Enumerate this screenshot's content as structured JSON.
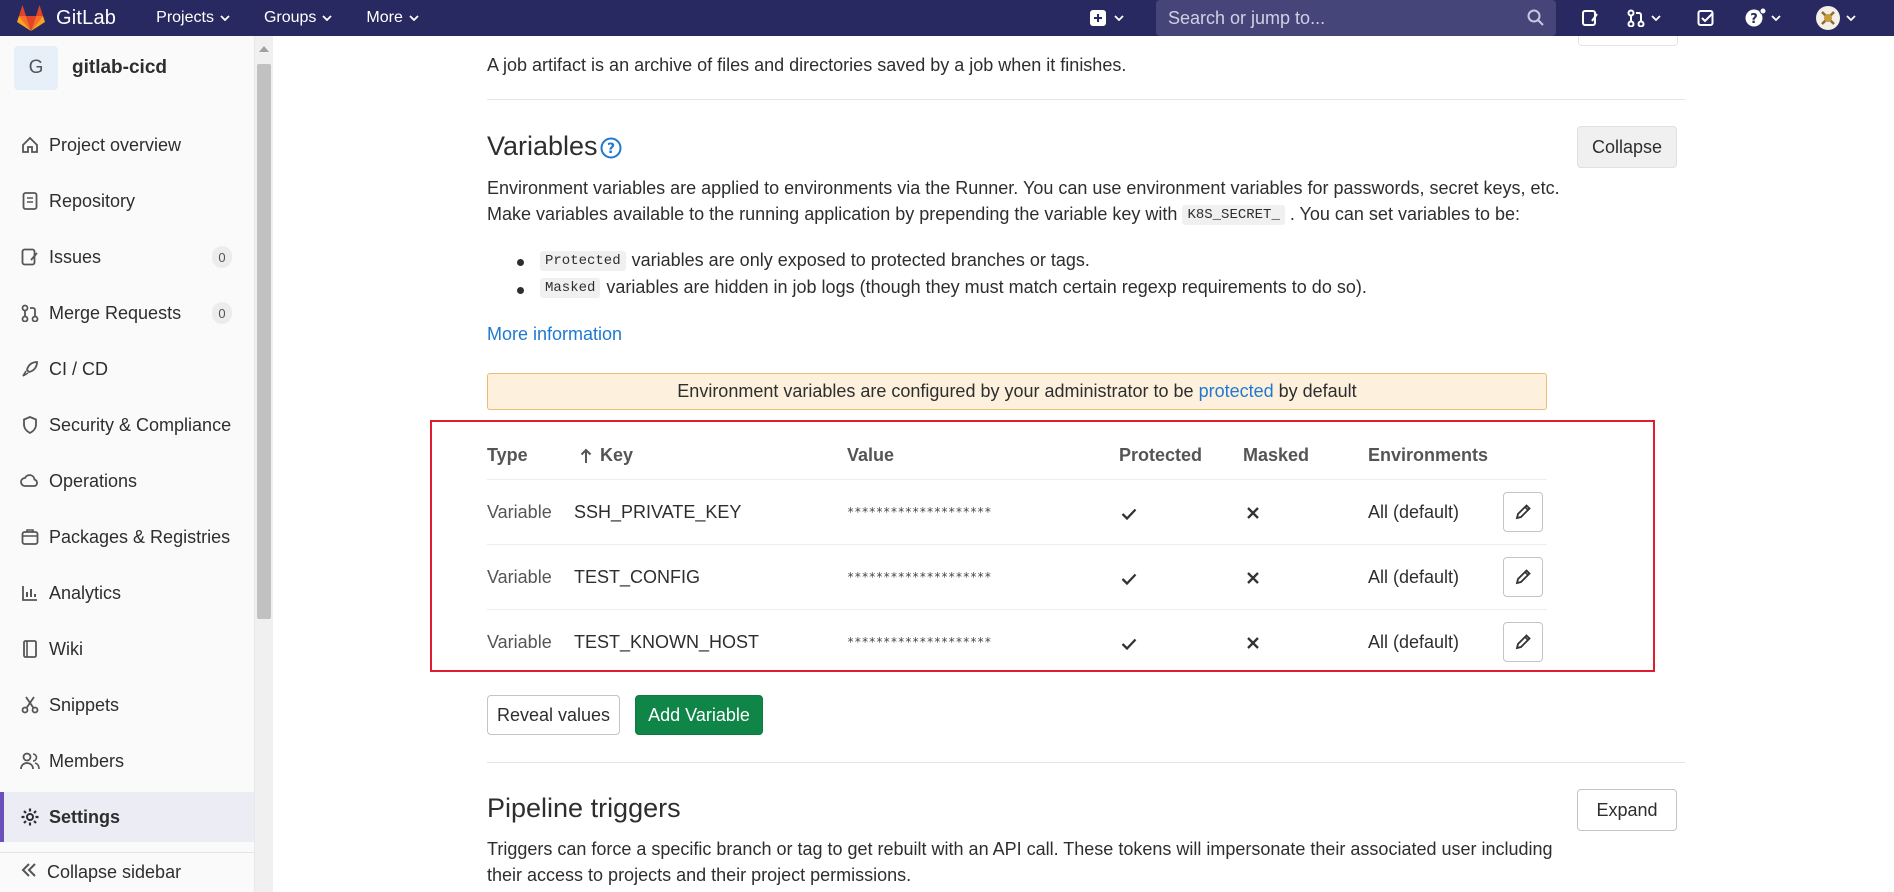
{
  "topnav": {
    "brand": "GitLab",
    "menu": [
      {
        "label": "Projects"
      },
      {
        "label": "Groups"
      },
      {
        "label": "More"
      }
    ],
    "search_placeholder": "Search or jump to...",
    "icons": [
      "plus-square-icon",
      "search-icon",
      "issues-icon",
      "merge-request-icon",
      "todo-icon",
      "help-icon",
      "user-avatar"
    ]
  },
  "sidebar": {
    "project_initial": "G",
    "project_name": "gitlab-cicd",
    "items": [
      {
        "label": "Project overview",
        "icon": "home-icon"
      },
      {
        "label": "Repository",
        "icon": "doc-icon"
      },
      {
        "label": "Issues",
        "icon": "issues-icon",
        "count": "0"
      },
      {
        "label": "Merge Requests",
        "icon": "merge-request-icon",
        "count": "0"
      },
      {
        "label": "CI / CD",
        "icon": "rocket-icon"
      },
      {
        "label": "Security & Compliance",
        "icon": "shield-icon"
      },
      {
        "label": "Operations",
        "icon": "cloud-icon"
      },
      {
        "label": "Packages & Registries",
        "icon": "package-icon"
      },
      {
        "label": "Analytics",
        "icon": "chart-icon"
      },
      {
        "label": "Wiki",
        "icon": "book-icon"
      },
      {
        "label": "Snippets",
        "icon": "scissors-icon"
      },
      {
        "label": "Members",
        "icon": "users-icon"
      },
      {
        "label": "Settings",
        "icon": "gear-icon",
        "active": true
      }
    ],
    "collapse_label": "Collapse sidebar"
  },
  "main": {
    "artifacts_desc": "A job artifact is an archive of files and directories saved by a job when it finishes.",
    "variables": {
      "title": "Variables",
      "collapse_label": "Collapse",
      "desc_line1": "Environment variables are applied to environments via the Runner. You can use environment variables for passwords, secret keys, etc.",
      "desc_line2_pre": "Make variables available to the running application by prepending the variable key with",
      "desc_line2_code": "K8S_SECRET_",
      "desc_line2_post": ". You can set variables to be:",
      "bullet1_code": "Protected",
      "bullet1_text": "variables are only exposed to protected branches or tags.",
      "bullet2_code": "Masked",
      "bullet2_text": "variables are hidden in job logs (though they must match certain regexp requirements to do so).",
      "more_info": "More information",
      "alert_pre": "Environment variables are configured by your administrator to be",
      "alert_link": "protected",
      "alert_post": "by default",
      "table": {
        "headers": {
          "type": "Type",
          "key": "Key",
          "value": "Value",
          "protected": "Protected",
          "masked": "Masked",
          "environments": "Environments"
        },
        "rows": [
          {
            "type": "Variable",
            "key": "SSH_PRIVATE_KEY",
            "value": "********************",
            "protected": true,
            "masked": false,
            "environment": "All (default)"
          },
          {
            "type": "Variable",
            "key": "TEST_CONFIG",
            "value": "********************",
            "protected": true,
            "masked": false,
            "environment": "All (default)"
          },
          {
            "type": "Variable",
            "key": "TEST_KNOWN_HOST",
            "value": "********************",
            "protected": true,
            "masked": false,
            "environment": "All (default)"
          }
        ]
      },
      "reveal_label": "Reveal values",
      "add_label": "Add Variable"
    },
    "triggers": {
      "title": "Pipeline triggers",
      "expand_label": "Expand",
      "desc_line1": "Triggers can force a specific branch or tag to get rebuilt with an API call. These tokens will impersonate their associated user including",
      "desc_line2": "their access to projects and their project permissions."
    }
  }
}
